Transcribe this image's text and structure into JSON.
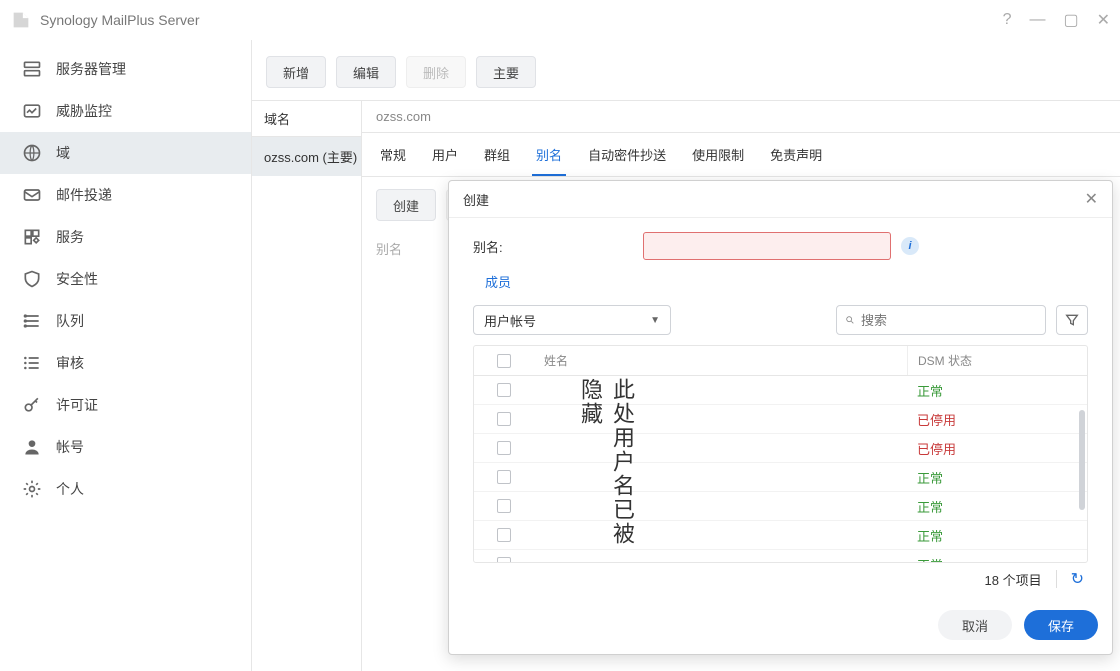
{
  "app": {
    "title": "Synology MailPlus Server"
  },
  "sidebar": {
    "items": [
      {
        "label": "服务器管理",
        "icon": "server-icon"
      },
      {
        "label": "威胁监控",
        "icon": "shield-chart-icon"
      },
      {
        "label": "域",
        "icon": "globe-icon",
        "active": true
      },
      {
        "label": "邮件投递",
        "icon": "mail-out-icon"
      },
      {
        "label": "服务",
        "icon": "apps-icon"
      },
      {
        "label": "安全性",
        "icon": "shield-icon"
      },
      {
        "label": "队列",
        "icon": "queue-icon"
      },
      {
        "label": "审核",
        "icon": "list-icon"
      },
      {
        "label": "许可证",
        "icon": "key-icon"
      },
      {
        "label": "帐号",
        "icon": "user-icon"
      },
      {
        "label": "个人",
        "icon": "gear-icon"
      }
    ]
  },
  "toolbar": {
    "add": "新增",
    "edit": "编辑",
    "delete": "删除",
    "primary": "主要"
  },
  "domain_column_header": "域名",
  "domain_item": "ozss.com (主要)",
  "detail_title": "ozss.com",
  "tabs": [
    {
      "label": "常规"
    },
    {
      "label": "用户"
    },
    {
      "label": "群组"
    },
    {
      "label": "别名",
      "active": true
    },
    {
      "label": "自动密件抄送"
    },
    {
      "label": "使用限制"
    },
    {
      "label": "免责声明"
    }
  ],
  "subtoolbar": {
    "create": "创建"
  },
  "alias_header": "别名",
  "modal": {
    "title": "创建",
    "alias_label": "别名:",
    "alias_value": "",
    "members_link": "成员",
    "account_type_select": "用户帐号",
    "search_placeholder": "搜索",
    "columns": {
      "name": "姓名",
      "status": "DSM 状态"
    },
    "name_overlay": "此处用户名已被隐藏",
    "rows": [
      {
        "status_text": "正常",
        "status_kind": "ok"
      },
      {
        "status_text": "已停用",
        "status_kind": "disabled"
      },
      {
        "status_text": "已停用",
        "status_kind": "disabled"
      },
      {
        "status_text": "正常",
        "status_kind": "ok"
      },
      {
        "status_text": "正常",
        "status_kind": "ok"
      },
      {
        "status_text": "正常",
        "status_kind": "ok"
      },
      {
        "status_text": "正常",
        "status_kind": "ok"
      }
    ],
    "footer_count": "18 个项目",
    "cancel": "取消",
    "save": "保存"
  }
}
